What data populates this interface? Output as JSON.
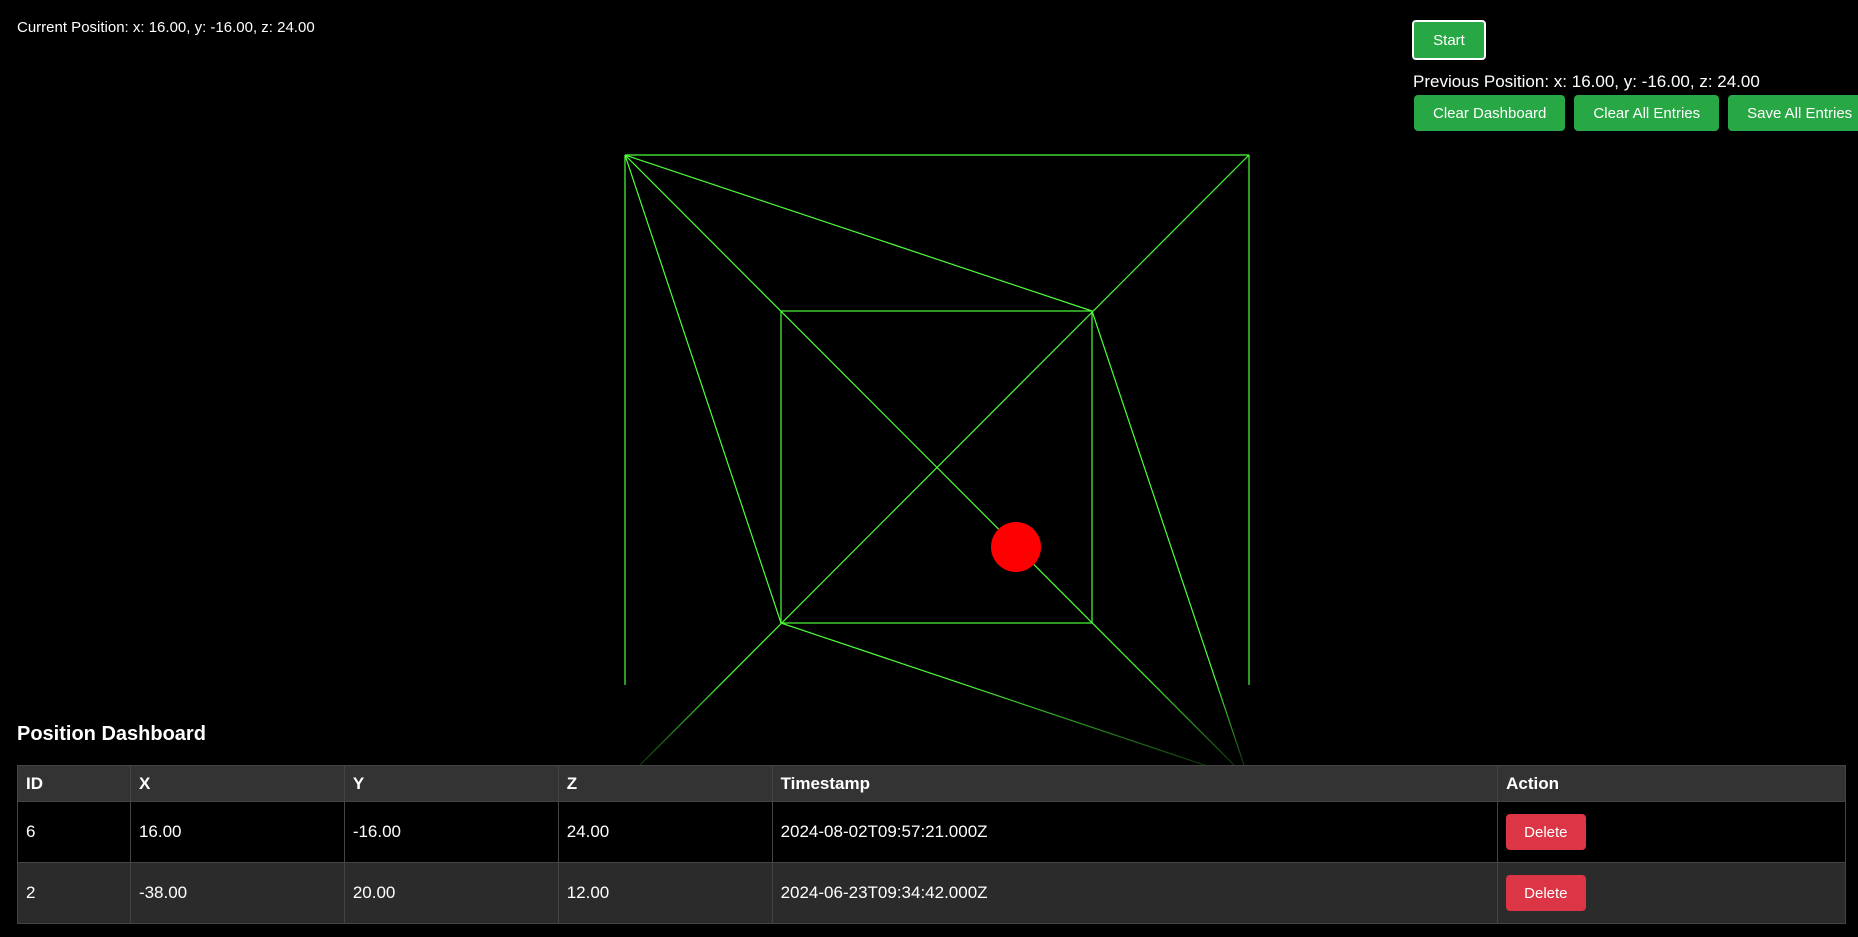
{
  "current_position": "Current Position: x: 16.00, y: -16.00, z: 24.00",
  "controls": {
    "start_label": "Start",
    "previous_position": "Previous Position: x: 16.00, y: -16.00, z: 24.00",
    "clear_dashboard_label": "Clear Dashboard",
    "clear_all_label": "Clear All Entries",
    "save_all_label": "Save All Entries"
  },
  "colors": {
    "background": "#000000",
    "wire": "#4cff3a",
    "sphere": "#ff0000",
    "button_green": "#28a745",
    "button_red": "#dc3545"
  },
  "dashboard": {
    "title": "Position Dashboard",
    "headers": [
      "ID",
      "X",
      "Y",
      "Z",
      "Timestamp",
      "Action"
    ],
    "rows": [
      {
        "id": "6",
        "x": "16.00",
        "y": "-16.00",
        "z": "24.00",
        "timestamp": "2024-08-02T09:57:21.000Z",
        "action": "Delete"
      },
      {
        "id": "2",
        "x": "-38.00",
        "y": "20.00",
        "z": "12.00",
        "timestamp": "2024-06-23T09:34:42.000Z",
        "action": "Delete"
      }
    ]
  }
}
